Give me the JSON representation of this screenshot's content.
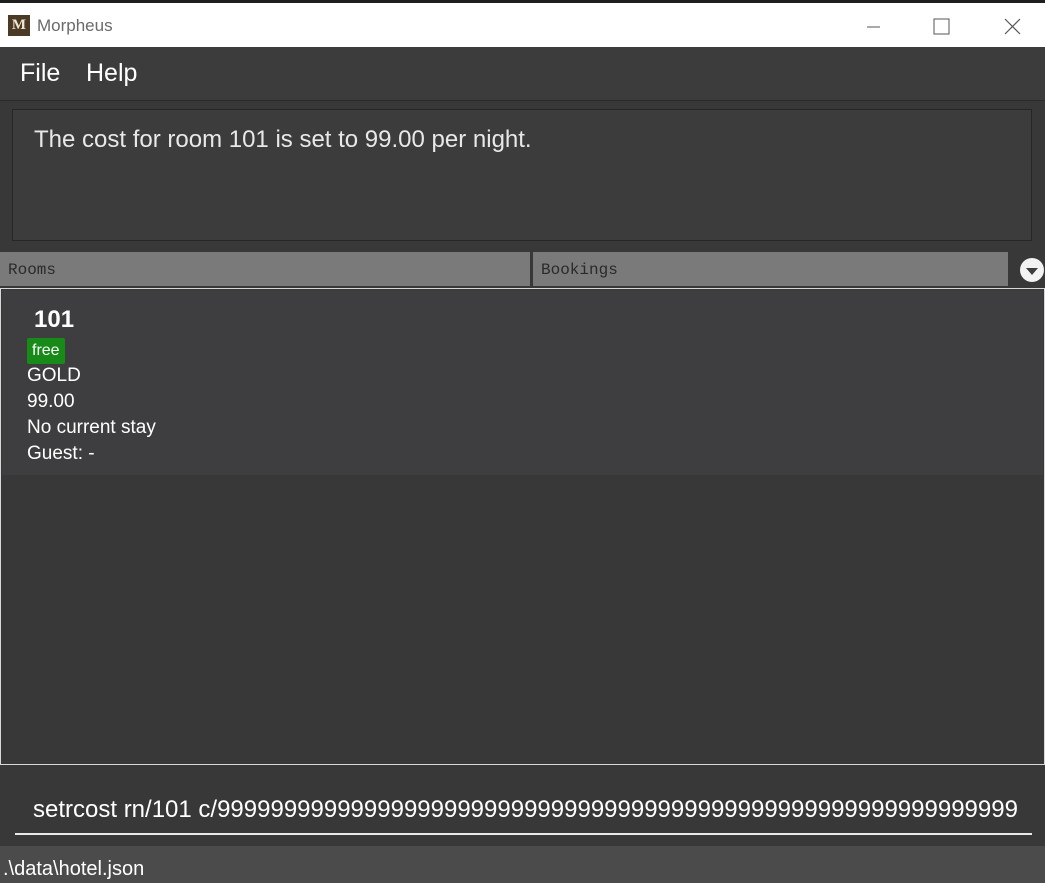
{
  "window": {
    "icon_letter": "M",
    "title": "Morpheus"
  },
  "menu": {
    "file": "File",
    "help": "Help"
  },
  "result": {
    "message": "The cost for room 101 is set to 99.00 per night."
  },
  "tabs": [
    {
      "label": "Rooms"
    },
    {
      "label": "Bookings"
    }
  ],
  "rooms": [
    {
      "number": "101",
      "status": "free",
      "tier": "GOLD",
      "cost": "99.00",
      "stay": "No current stay",
      "guest": "Guest: -"
    }
  ],
  "command": {
    "value": "setrcost rn/101 c/999999999999999999999999999999999999999999999999999999999999"
  },
  "status_bar": {
    "path": ".\\data\\hotel.json"
  },
  "colors": {
    "background": "#3c3c3c",
    "status_free": "#178a17",
    "tab": "#7a7a7a"
  }
}
